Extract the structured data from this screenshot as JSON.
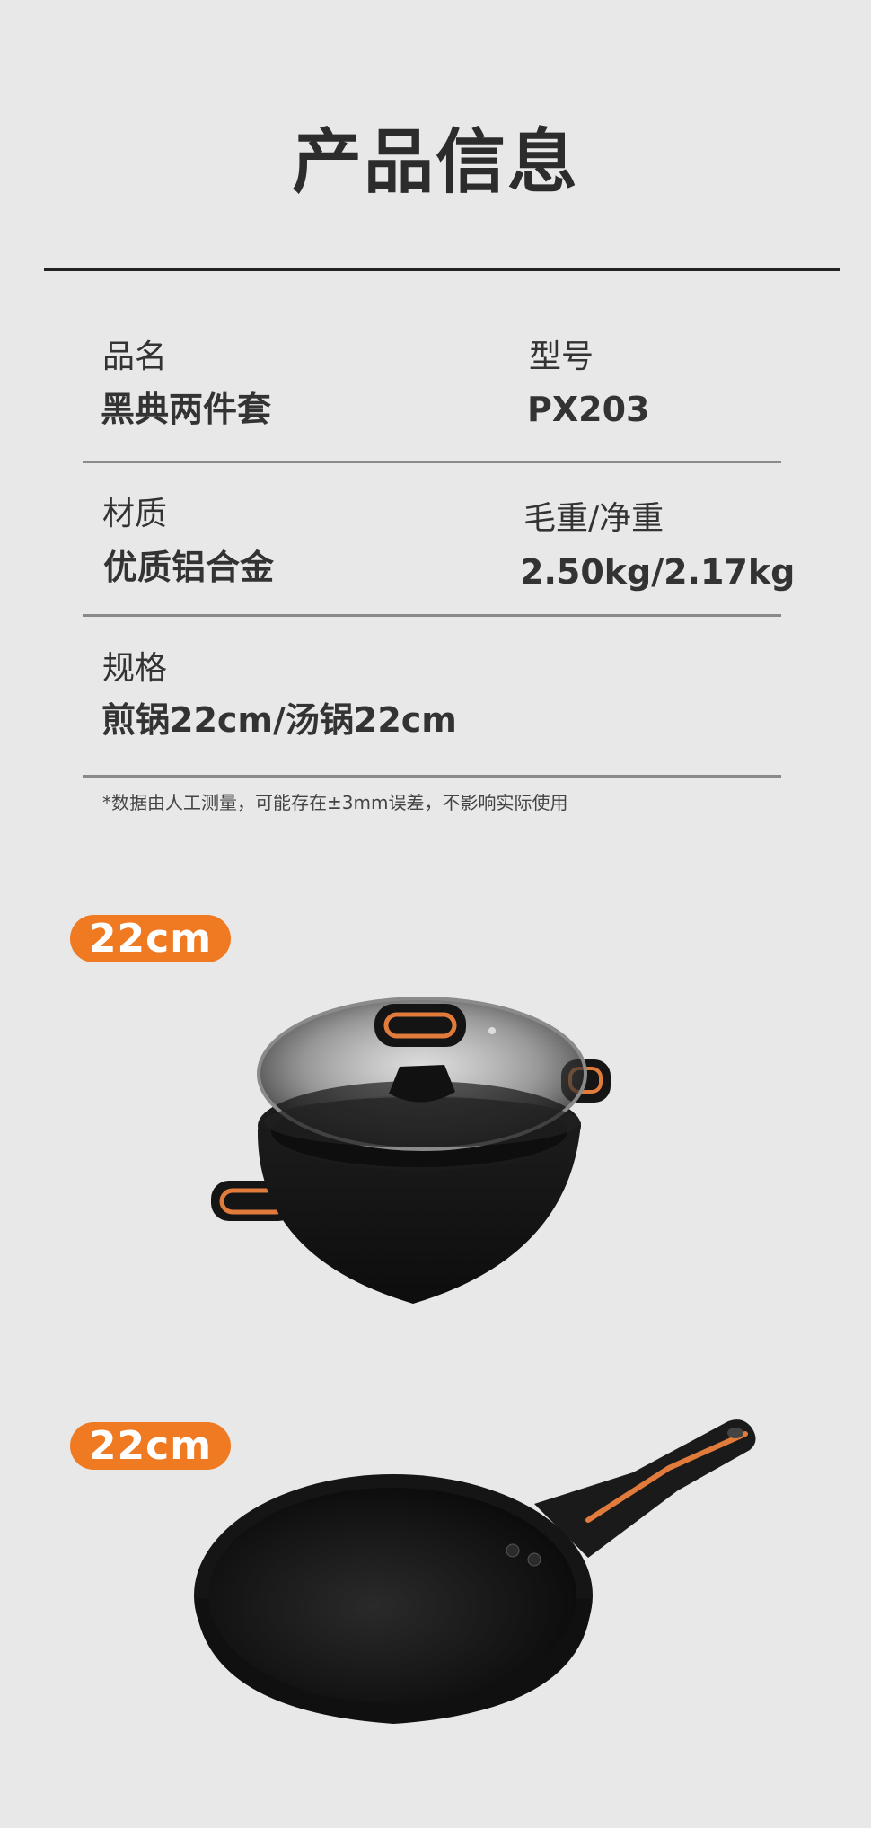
{
  "page_title": "产品信息",
  "specs": {
    "name_label": "品名",
    "name_value": "黑典两件套",
    "model_label": "型号",
    "model_value": "PX203",
    "material_label": "材质",
    "material_value": "优质铝合金",
    "weight_label": "毛重/净重",
    "weight_value": "2.50kg/2.17kg",
    "spec_label": "规格",
    "spec_value": "煎锅22cm/汤锅22cm"
  },
  "note": "*数据由人工测量，可能存在±3mm误差，不影响实际使用",
  "products": [
    {
      "size": "22cm",
      "image": "soup-pot-with-glass-lid"
    },
    {
      "size": "22cm",
      "image": "frying-pan"
    }
  ],
  "colors": {
    "accent": "#f07a21",
    "background": "#e8e8e8",
    "text": "#333333"
  }
}
